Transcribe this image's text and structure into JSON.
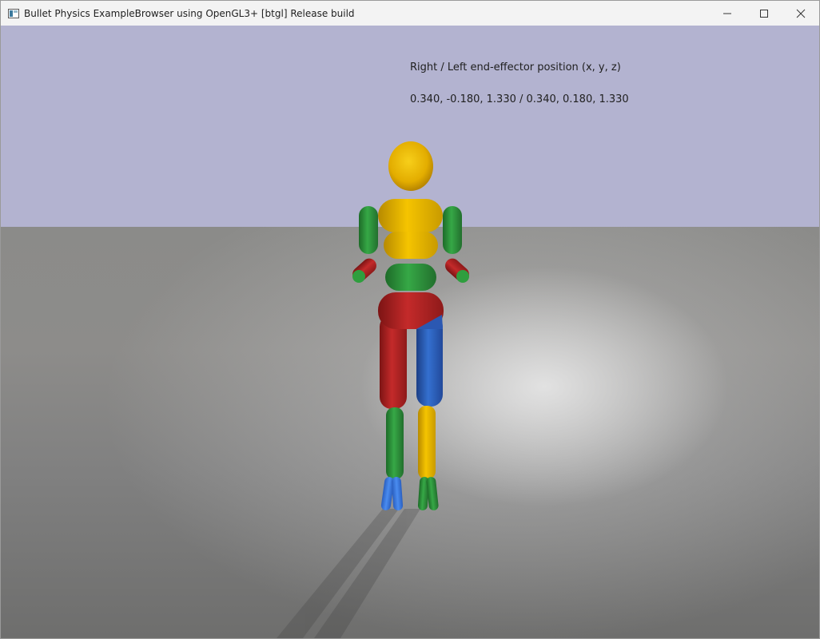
{
  "window": {
    "title": "Bullet Physics ExampleBrowser using OpenGL3+ [btgl] Release build",
    "app_icon": "app-window-icon",
    "controls": [
      "minimize-icon",
      "maximize-icon",
      "close-icon"
    ]
  },
  "overlay": {
    "heading": "Right / Left end-effector position (x, y, z)",
    "values": "0.340, -0.180, 1.330 / 0.340, 0.180, 1.330"
  },
  "colors": {
    "sky": "#b3b3d0",
    "ground": "#8a8a88",
    "yellow": "#e8b400",
    "green": "#2e9a3c",
    "red": "#b32222",
    "blue": "#2d5fbf"
  }
}
